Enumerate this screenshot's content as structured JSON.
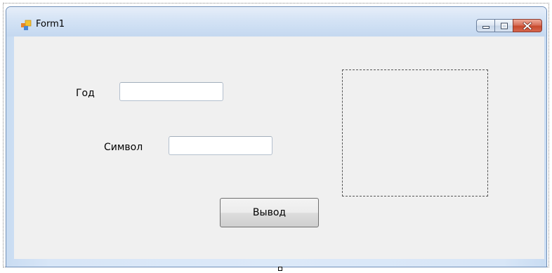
{
  "window": {
    "title": "Form1",
    "icons": {
      "app": "form-app-icon",
      "minimize": "minimize-icon",
      "maximize": "maximize-icon",
      "close": "close-icon"
    }
  },
  "form": {
    "year_label": "Год",
    "year_value": "",
    "symbol_label": "Символ",
    "symbol_value": "",
    "output_button": "Вывод"
  },
  "colors": {
    "client_background": "#f0f0f0",
    "titlebar": "#d4e3f5",
    "close_button": "#c7492d"
  }
}
